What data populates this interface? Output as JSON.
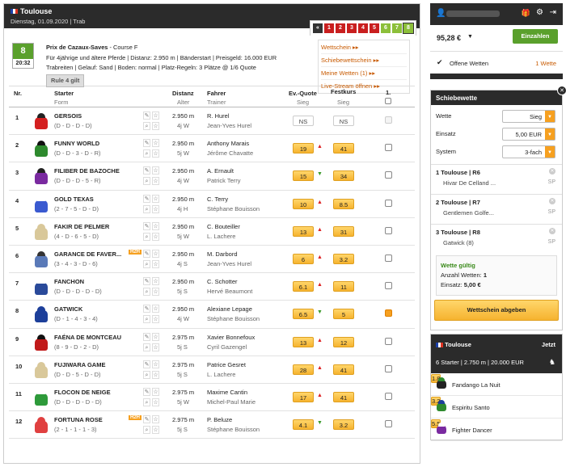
{
  "race": {
    "venue": "Toulouse",
    "date": "Dienstag, 01.09.2020",
    "type": "Trab",
    "race_numbers": [
      "1",
      "2",
      "3",
      "4",
      "5",
      "6",
      "7",
      "8"
    ],
    "race_colors": [
      "#c91f1f",
      "#c91f1f",
      "#c91f1f",
      "#c91f1f",
      "#c91f1f",
      "#8cbf3a",
      "#8cbf3a",
      "#8cbf3a"
    ],
    "nav_prev": "«",
    "current": "8",
    "time": "20:32",
    "title": "Prix de Cazaux-Saves",
    "course": " - Course F",
    "line1": "Für 4jährige und ältere Pferde  |  Distanz: 2.950 m  |  Bänderstart  |  Preisgeld: 16.000 EUR",
    "line2": "Trabreiten  |  Gelauf: Sand  |  Boden: normal  |  Platz-Regeln: 3 Plätze @ 1/6 Quote",
    "rule": "Rule 4 gilt"
  },
  "links": [
    "Wettschein ▸▸",
    "Schiebewettschein ▸▸",
    "Meine Wetten (1) ▸▸",
    "Live-Stream öffnen ▸▸"
  ],
  "cols": {
    "nr": "Nr.",
    "starter": "Starter",
    "form": "Form",
    "distance": "Distanz",
    "age": "Alter",
    "driver": "Fahrer",
    "trainer": "Trainer",
    "evq": "Ev.-Quote",
    "evq_sub": "Sieg",
    "fk": "Festkurs",
    "fk_sub": "Sieg",
    "first": "1."
  },
  "runners": [
    {
      "no": "1",
      "name": "GERSOIS",
      "form": "(D - D - D - D)",
      "dist": "2.950 m",
      "age": "4j W",
      "driver": "R. Hurel",
      "trainer": "Jean-Yves Hurel",
      "ev": "NS",
      "arrow": "",
      "fk": "NS",
      "silk": "#d42020",
      "cap": "#222",
      "cb": "dis",
      "tag": ""
    },
    {
      "no": "2",
      "name": "FUNNY WORLD",
      "form": "(D - D - 3 - D - R)",
      "dist": "2.950 m",
      "age": "5j W",
      "driver": "Anthony Marais",
      "trainer": "Jérôme Chavatte",
      "ev": "19",
      "arrow": "▲",
      "fk": "41",
      "silk": "#2e8a2e",
      "cap": "#111",
      "cb": "",
      "tag": ""
    },
    {
      "no": "3",
      "name": "FILIBER DE BAZOCHE",
      "form": "(D - D - D - 5 - R)",
      "dist": "2.950 m",
      "age": "4j W",
      "driver": "A. Ernault",
      "trainer": "Patrick Terry",
      "ev": "15",
      "arrow": "▼",
      "fk": "34",
      "silk": "#7a2aa0",
      "cap": "#222",
      "cb": "",
      "tag": ""
    },
    {
      "no": "4",
      "name": "GOLD TEXAS",
      "form": "(2 - 7 - 5 - D - D)",
      "dist": "2.950 m",
      "age": "4j H",
      "driver": "C. Terry",
      "trainer": "Stéphane Bouisson",
      "ev": "10",
      "arrow": "▲",
      "fk": "8.5",
      "silk": "#3a5ad0",
      "cap": "#ffffff",
      "cb": "",
      "tag": ""
    },
    {
      "no": "5",
      "name": "FAKIR DE PELMER",
      "form": "(4 - D - 6 - 5 - D)",
      "dist": "2.950 m",
      "age": "5j W",
      "driver": "C. Bouteiller",
      "trainer": "L. Lachere",
      "ev": "13",
      "arrow": "▲",
      "fk": "31",
      "silk": "#d9c89a",
      "cap": "#d9c89a",
      "cb": "",
      "tag": ""
    },
    {
      "no": "6",
      "name": "GARANCE DE FAVER...",
      "form": "(3 - 4 - 3 - D - 6)",
      "dist": "2.950 m",
      "age": "4j S",
      "driver": "M. Darbord",
      "trainer": "Jean-Yves Hurel",
      "ev": "6",
      "arrow": "▲",
      "fk": "3.2",
      "silk": "#5a7ab8",
      "cap": "#333",
      "cb": "",
      "tag": "H2H"
    },
    {
      "no": "7",
      "name": "FANCHON",
      "form": "(D - D - D - D - D)",
      "dist": "2.950 m",
      "age": "5j S",
      "driver": "C. Schotter",
      "trainer": "Hervé Beaumont",
      "ev": "6.1",
      "arrow": "▲",
      "fk": "11",
      "silk": "#2a4a9a",
      "cap": "#fff",
      "cb": "",
      "tag": ""
    },
    {
      "no": "8",
      "name": "GATWICK",
      "form": "(D - 1 - 4 - 3 - 4)",
      "dist": "2.950 m",
      "age": "4j W",
      "driver": "Alexiane Lepage",
      "trainer": "Stéphane Bouisson",
      "ev": "6.5",
      "arrow": "▼",
      "fk": "5",
      "silk": "#1d3f9a",
      "cap": "#1d3f9a",
      "cb": "chk",
      "tag": ""
    },
    {
      "no": "9",
      "name": "FAÉNA DE MONTCEAU",
      "form": "(8 - 9 - D - 2 - D)",
      "dist": "2.975 m",
      "age": "5j S",
      "driver": "Xavier Bonnefoux",
      "trainer": "Cyril Gazengel",
      "ev": "13",
      "arrow": "▲",
      "fk": "12",
      "silk": "#c11a1a",
      "cap": "#111",
      "cb": "",
      "tag": ""
    },
    {
      "no": "10",
      "name": "FUJIWARA GAME",
      "form": "(D - D - 5 - D - D)",
      "dist": "2.975 m",
      "age": "5j S",
      "driver": "Patrice Gesret",
      "trainer": "L. Lachere",
      "ev": "28",
      "arrow": "▲",
      "fk": "41",
      "silk": "#d9c89a",
      "cap": "#d9c89a",
      "cb": "",
      "tag": ""
    },
    {
      "no": "11",
      "name": "FLOCON DE NEIGE",
      "form": "(D - D - D - D - D)",
      "dist": "2.975 m",
      "age": "5j W",
      "driver": "Maxime Cantin",
      "trainer": "Michel-Paul Marie",
      "ev": "17",
      "arrow": "▲",
      "fk": "41",
      "silk": "#2e9a3a",
      "cap": "#fff",
      "cb": "",
      "tag": ""
    },
    {
      "no": "12",
      "name": "FORTUNA ROSE",
      "form": "(2 - 1 - 1 - 1 - 3)",
      "dist": "2.975 m",
      "age": "5j S",
      "driver": "P. Beluze",
      "trainer": "Stéphane Bouisson",
      "ev": "4.1",
      "arrow": "▼",
      "fk": "3.2",
      "silk": "#e04040",
      "cap": "#e04040",
      "cb": "",
      "tag": "H2H"
    }
  ],
  "account": {
    "balance": "95,28 €",
    "deposit": "Einzahlen",
    "open_bets": "Offene Wetten",
    "open_count": "1 Wette"
  },
  "slip": {
    "title": "Schiebewette",
    "bet_label": "Wette",
    "bet_value": "Sieg",
    "stake_label": "Einsatz",
    "stake_value": "5,00 EUR",
    "system_label": "System",
    "system_value": "3-fach",
    "bets": [
      {
        "n": "1",
        "race": "Toulouse | R6",
        "horse": "Hivar De Celland ...",
        "sp": "SP"
      },
      {
        "n": "2",
        "race": "Toulouse | R7",
        "horse": "Gentlemen Golfe...",
        "sp": "SP"
      },
      {
        "n": "3",
        "race": "Toulouse | R8",
        "horse": "Gatwick (8)",
        "sp": "SP"
      }
    ],
    "valid": "Wette gültig",
    "count_label": "Anzahl Wetten:",
    "count": "1",
    "stake_sum_label": "Einsatz:",
    "stake_sum": "5,00 €",
    "submit": "Wettschein abgeben"
  },
  "live": {
    "venue": "Toulouse",
    "now": "Jetzt",
    "info": "6 Starter  |  2.750 m  |  20.000 EUR",
    "runners": [
      {
        "name": "Fandango La Nuit",
        "odds": "1.8",
        "silk": "#222",
        "cap": "#2e8a2e"
      },
      {
        "name": "Espiritu Santo",
        "odds": "3.2",
        "silk": "#2e8a2e",
        "cap": "#1d3f9a"
      },
      {
        "name": "Fighter Dancer",
        "odds": "5.5",
        "silk": "#7a2aa0",
        "cap": "#fff"
      }
    ]
  }
}
